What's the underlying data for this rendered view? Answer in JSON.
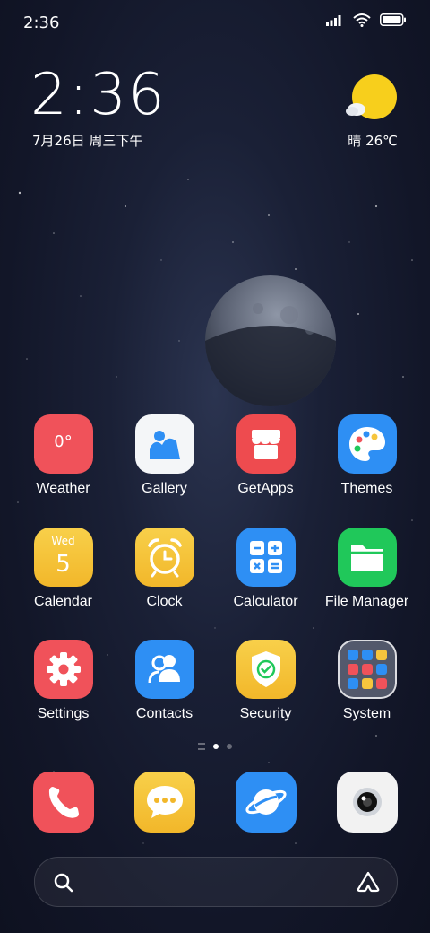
{
  "status_bar": {
    "time": "2:36"
  },
  "clock_widget": {
    "time": "2:36",
    "date": "7月26日 周三下午"
  },
  "weather_widget": {
    "text": "晴 26℃"
  },
  "apps": [
    {
      "id": "weather",
      "label": "Weather",
      "icon": "weather-icon",
      "tile_text": "0°",
      "color": "#f0525a"
    },
    {
      "id": "gallery",
      "label": "Gallery",
      "icon": "gallery-icon",
      "color": "#f4f6f8"
    },
    {
      "id": "getapps",
      "label": "GetApps",
      "icon": "store-icon",
      "color": "#ee4b4f"
    },
    {
      "id": "themes",
      "label": "Themes",
      "icon": "palette-icon",
      "color": "#2e8ff4"
    },
    {
      "id": "calendar",
      "label": "Calendar",
      "icon": "calendar-icon",
      "tile_day": "Wed",
      "tile_date": "5",
      "color": "#f6c53d"
    },
    {
      "id": "clock",
      "label": "Clock",
      "icon": "alarm-clock-icon",
      "color": "#f6c53d"
    },
    {
      "id": "calculator",
      "label": "Calculator",
      "icon": "calculator-icon",
      "color": "#2e8ff4"
    },
    {
      "id": "file_manager",
      "label": "File Manager",
      "icon": "folder-icon",
      "color": "#20c85a"
    },
    {
      "id": "settings",
      "label": "Settings",
      "icon": "gear-icon",
      "color": "#f0525a"
    },
    {
      "id": "contacts",
      "label": "Contacts",
      "icon": "contacts-icon",
      "color": "#2e8ff4"
    },
    {
      "id": "security",
      "label": "Security",
      "icon": "shield-icon",
      "color": "#f6c53d"
    },
    {
      "id": "system",
      "label": "System",
      "icon": "folder-grid-icon",
      "color": "#dfe5ee"
    }
  ],
  "dock": [
    {
      "id": "phone",
      "icon": "phone-icon",
      "color": "#f0525a"
    },
    {
      "id": "messages",
      "icon": "message-icon",
      "color": "#f6c53d"
    },
    {
      "id": "browser",
      "icon": "browser-icon",
      "color": "#2e8ff4"
    },
    {
      "id": "camera",
      "icon": "camera-icon",
      "color": "#f2f2f2"
    }
  ],
  "page_indicator": {
    "pages": 2,
    "current": 1
  }
}
